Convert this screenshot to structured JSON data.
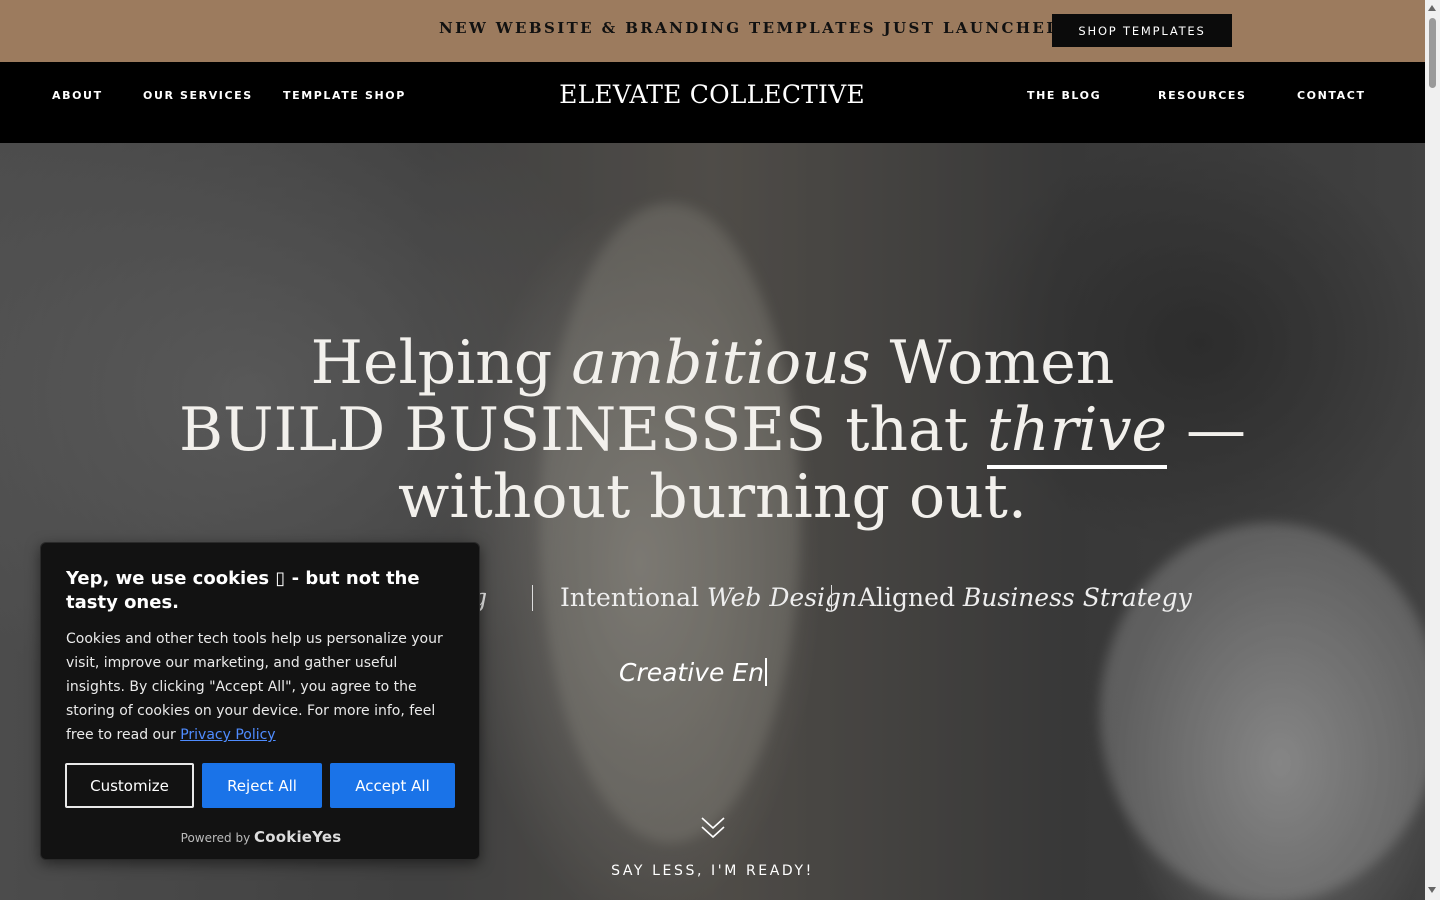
{
  "announcement": {
    "text": "NEW WEBSITE & BRANDING TEMPLATES JUST LAUNCHED!",
    "button_label": "SHOP TEMPLATES"
  },
  "nav": {
    "brand": "ELEVATE COLLECTIVE",
    "left": [
      "ABOUT",
      "OUR SERVICES",
      "TEMPLATE SHOP"
    ],
    "right": [
      "THE BLOG",
      "RESOURCES",
      "CONTACT"
    ]
  },
  "hero": {
    "line1": {
      "a": "Helping ",
      "b": "ambitious",
      "c": " Women"
    },
    "line2": {
      "a": "BUILD BUSINESSES that ",
      "b": "thrive",
      "c": " —"
    },
    "line3": "without burning out.",
    "services": [
      {
        "a": "",
        "b": "ng"
      },
      {
        "a": "Intentional ",
        "b": "Web Design"
      },
      {
        "a": "Aligned ",
        "b": "Business Strategy"
      }
    ],
    "typing_text": "Creative En",
    "scroll_label": "SAY LESS, I'M READY!"
  },
  "cookie": {
    "title": "Yep, we use cookies ▯ - but not the tasty ones.",
    "body": "Cookies and other tech tools help us personalize your visit, improve our marketing, and gather useful insights. By clicking \"Accept All\", you agree to the storing of cookies on your device. For more info, feel free to read our ",
    "privacy_link": "Privacy Policy",
    "customize_label": "Customize",
    "reject_label": "Reject All",
    "accept_label": "Accept All",
    "powered_by": "Powered by",
    "powered_brand": "CookieYes"
  },
  "colors": {
    "announcement_bg": "#9c7b5e",
    "nav_bg": "#000000",
    "button_blue": "#1a73e8"
  }
}
